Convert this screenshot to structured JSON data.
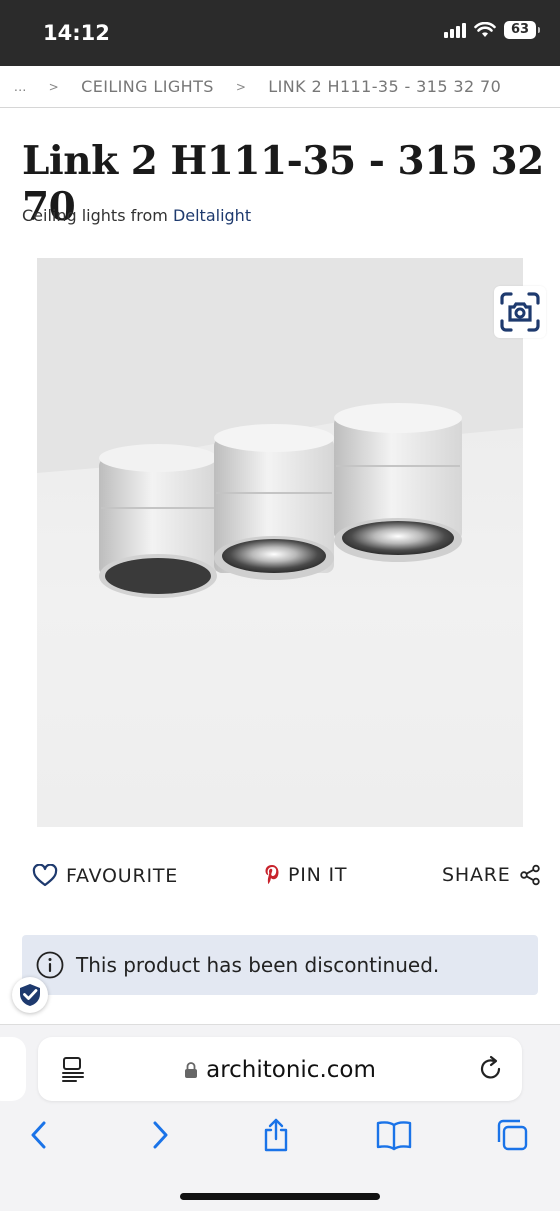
{
  "status_bar": {
    "time": "14:12",
    "battery": "63"
  },
  "breadcrumb": {
    "ellipsis": "...",
    "items": [
      "CEILING LIGHTS",
      "LINK 2 H111-35 - 315 32 70"
    ]
  },
  "product": {
    "title": "Link 2 H111-35 - 315 32 70",
    "subtitle_prefix": "Ceiling lights from ",
    "brand": "Deltalight"
  },
  "actions": {
    "favourite": "FAVOURITE",
    "pin": "PIN IT",
    "share": "SHARE"
  },
  "notice": {
    "text": "This product has been discontinued."
  },
  "browser": {
    "url": "architonic.com"
  },
  "colors": {
    "brand_link": "#1e3a6e",
    "accent_blue": "#1a73e8",
    "notice_bg": "#e3e8f2",
    "pin_red": "#c8232c"
  }
}
